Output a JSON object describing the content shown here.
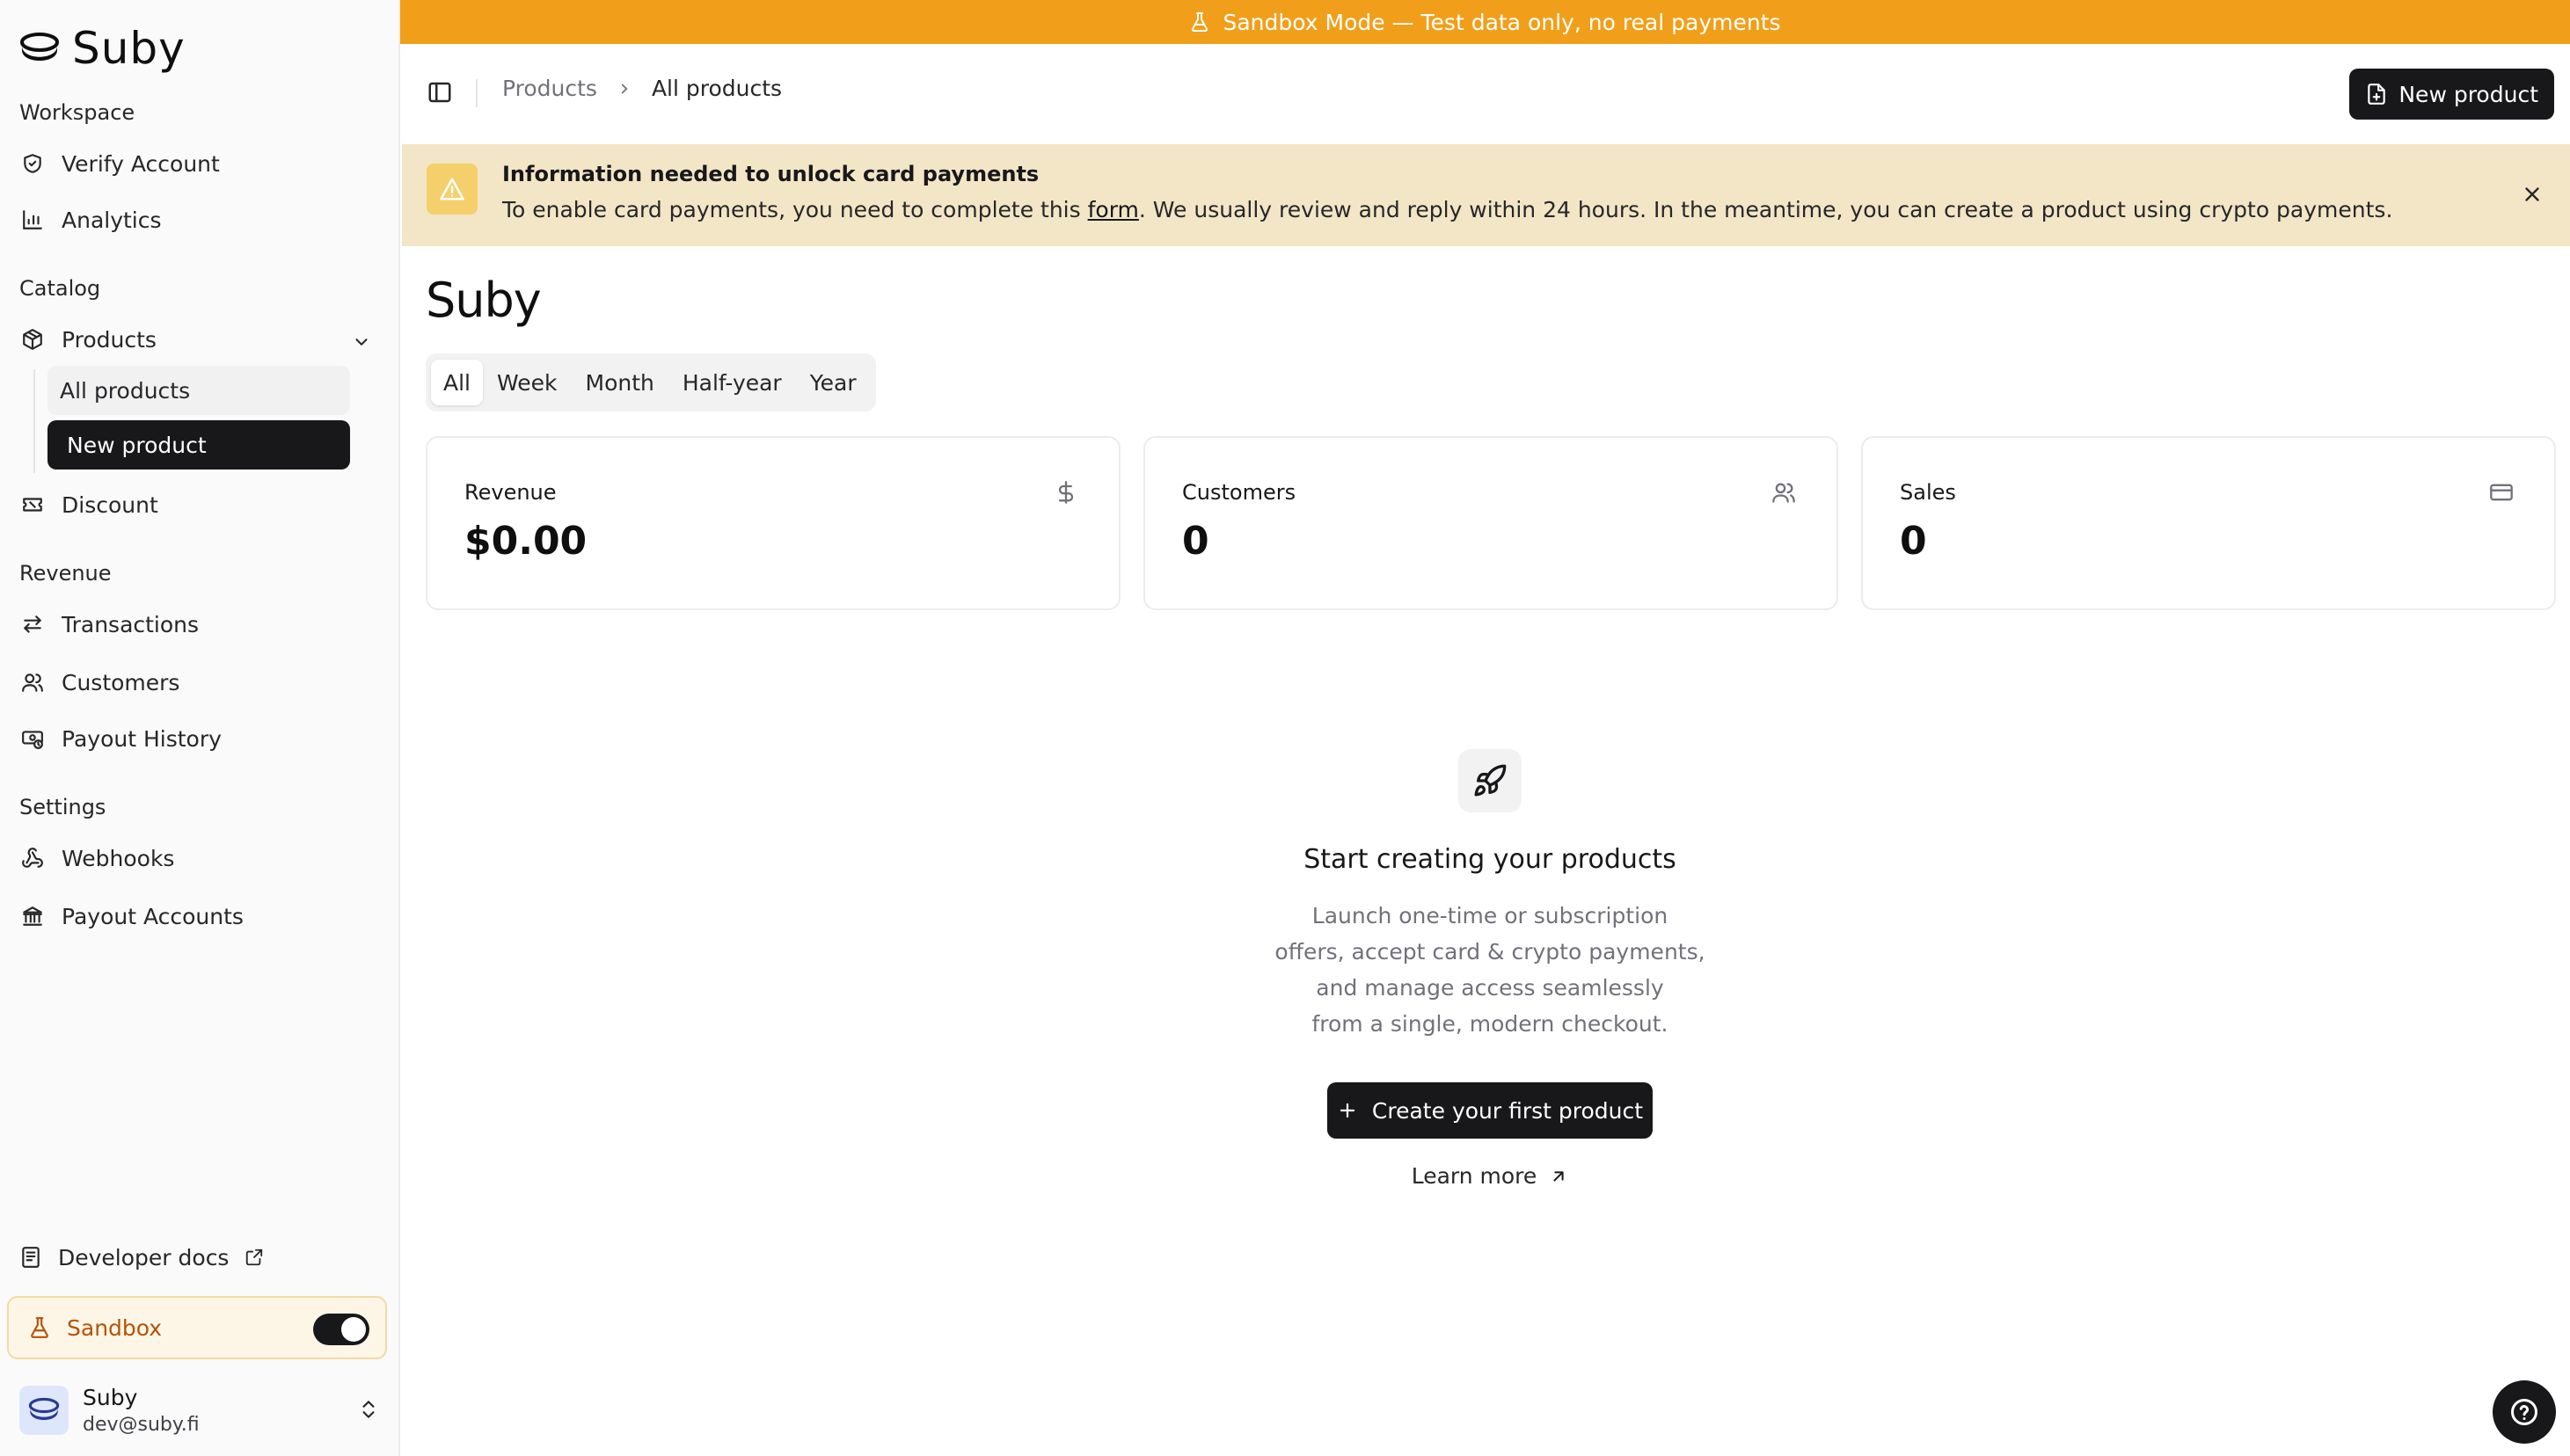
{
  "brand": {
    "name": "Suby"
  },
  "sidebar": {
    "sections": {
      "workspace": "Workspace",
      "catalog": "Catalog",
      "revenue": "Revenue",
      "settings": "Settings"
    },
    "items": {
      "verify_account": "Verify Account",
      "analytics": "Analytics",
      "products": "Products",
      "all_products": "All products",
      "new_product": "New product",
      "discount": "Discount",
      "transactions": "Transactions",
      "customers": "Customers",
      "payout_history": "Payout History",
      "webhooks": "Webhooks",
      "payout_accounts": "Payout Accounts"
    },
    "developer_docs": "Developer docs",
    "sandbox": {
      "label": "Sandbox",
      "enabled": true
    },
    "user": {
      "name": "Suby",
      "email": "dev@suby.fi"
    }
  },
  "sandbox_banner": {
    "text": "Sandbox Mode — Test data only, no real payments"
  },
  "topbar": {
    "breadcrumb": {
      "parent": "Products",
      "current": "All products"
    },
    "new_product_label": "New product"
  },
  "info_banner": {
    "title": "Information needed to unlock card payments",
    "text_before": "To enable card payments, you need to complete this ",
    "link": "form",
    "text_after": ". We usually review and reply within 24 hours. In the meantime, you can create a product using crypto payments."
  },
  "page": {
    "title": "Suby"
  },
  "periods": {
    "options": [
      "All",
      "Week",
      "Month",
      "Half-year",
      "Year"
    ],
    "selected": "All"
  },
  "stats": [
    {
      "label": "Revenue",
      "value": "$0.00",
      "icon": "dollar-icon"
    },
    {
      "label": "Customers",
      "value": "0",
      "icon": "users-icon"
    },
    {
      "label": "Sales",
      "value": "0",
      "icon": "credit-card-icon"
    }
  ],
  "empty_state": {
    "title": "Start creating your products",
    "description_lines": [
      "Launch one-time or subscription",
      "offers, accept card & crypto payments,",
      "and manage access seamlessly",
      "from a single, modern checkout."
    ],
    "cta": "Create your first product",
    "learn_more": "Learn more"
  },
  "colors": {
    "sandbox_banner": "#f19f1a",
    "info_banner": "#f2e6c6",
    "primary": "#18181b",
    "sandbox_text": "#b45309"
  }
}
